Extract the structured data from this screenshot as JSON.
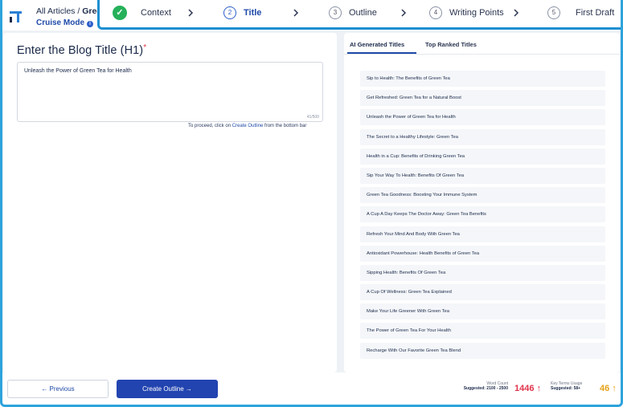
{
  "header": {
    "breadcrumb_root": "All Articles",
    "breadcrumb_sep": " / ",
    "breadcrumb_current": "Green",
    "mode_label": "Cruise Mode",
    "mode_info_icon": "info-icon"
  },
  "stepper": {
    "steps": [
      {
        "num": "",
        "label": "Context",
        "state": "done"
      },
      {
        "num": "2",
        "label": "Title",
        "state": "active"
      },
      {
        "num": "3",
        "label": "Outline",
        "state": "pending"
      },
      {
        "num": "4",
        "label": "Writing Points",
        "state": "pending"
      },
      {
        "num": "5",
        "label": "First Draft",
        "state": "pending"
      }
    ]
  },
  "editor": {
    "heading": "Enter the Blog Title (H1)",
    "required_mark": "*",
    "title_value": "Unleash the Power of Green Tea for Health",
    "char_count": "41/500",
    "hint_prefix": "To proceed, click on ",
    "hint_link": "Create Outline",
    "hint_suffix": " from the bottom bar"
  },
  "suggestions": {
    "tabs": [
      "AI Generated Titles",
      "Top Ranked Titles"
    ],
    "active_tab": 0,
    "items": [
      "Sip to Health: The Benefits of Green Tea",
      "Get Refreshed: Green Tea for a Natural Boost",
      "Unleash the Power of Green Tea for Health",
      "The Secret to a Healthy Lifestyle: Green Tea",
      "Health in a Cup: Benefits of Drinking Green Tea",
      "Sip Your Way To Health: Benefits Of Green Tea",
      "Green Tea Goodness: Boosting Your Immune System",
      "A Cup A Day Keeps The Doctor Away: Green Tea Benefits",
      "Refresh Your Mind And Body With Green Tea",
      "Antioxidant Powerhouse: Health Benefits of Green Tea",
      "Sipping Health: Benefits Of Green Tea",
      "A Cup Of Wellness: Green Tea Explained",
      "Make Your Life Greener With Green Tea",
      "The Power of Green Tea For Your Health",
      "Recharge With Our Favorite Green Tea Blend"
    ]
  },
  "footer": {
    "previous_label": "← Previous",
    "create_label": "Create Outline →",
    "word_count_title": "Word Count",
    "word_count_suggested": "Suggested: 2100 - 2500",
    "word_count_value": "1446",
    "word_count_arrow": "↑",
    "key_terms_title": "Key Terms Usage",
    "key_terms_suggested": "Suggested: 58+",
    "key_terms_value": "46",
    "key_terms_arrow": "↑"
  },
  "colors": {
    "accent": "#2244b0",
    "frame": "#2ea3dc",
    "success": "#25b05a",
    "danger": "#e0334b",
    "warning": "#e6a21a"
  }
}
